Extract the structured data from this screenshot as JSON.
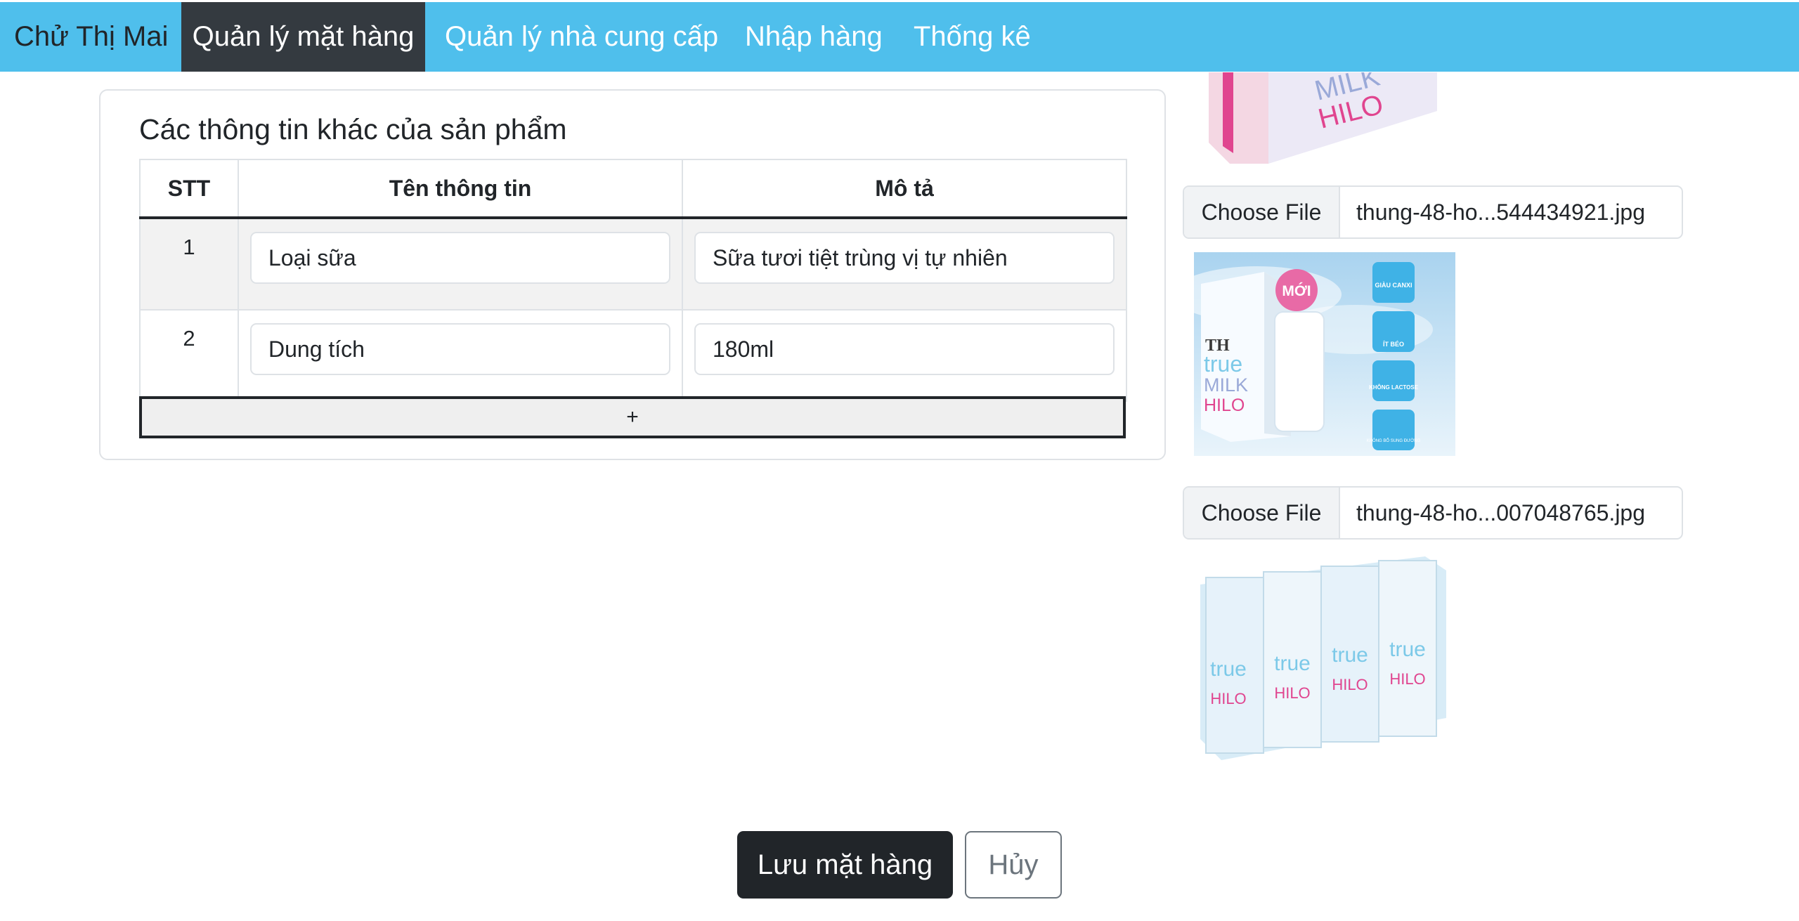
{
  "nav": {
    "brand": "Chử Thị Mai",
    "items": [
      {
        "label": "Quản lý mặt hàng",
        "active": true
      },
      {
        "label": "Quản lý nhà cung cấp",
        "active": false
      },
      {
        "label": "Nhập hàng",
        "active": false
      },
      {
        "label": "Thống kê",
        "active": false
      }
    ]
  },
  "info_card": {
    "title": "Các thông tin khác của sản phẩm",
    "columns": [
      "STT",
      "Tên thông tin",
      "Mô tả"
    ],
    "rows": [
      {
        "stt": "1",
        "name": "Loại sữa",
        "desc": "Sữa tươi tiệt trùng vị tự nhiên"
      },
      {
        "stt": "2",
        "name": "Dung tích",
        "desc": "180ml"
      }
    ],
    "add_label": "+"
  },
  "images": {
    "files": [
      {
        "button": "Choose File",
        "filename": "thung-48-ho...544434921.jpg"
      },
      {
        "button": "Choose File",
        "filename": "thung-48-ho...007048765.jpg"
      }
    ],
    "product_texts": {
      "brand": "TH",
      "true": "true",
      "milk": "MILK",
      "hilo": "HILO",
      "new_badge": "MỚI",
      "feature_1": "GIÀU CANXI",
      "feature_2": "ÍT BÉO",
      "feature_3": "KHÔNG LACTOSE",
      "feature_4": "KHÔNG BỔ SUNG ĐƯỜNG"
    }
  },
  "actions": {
    "save": "Lưu mặt hàng",
    "cancel": "Hủy"
  },
  "colors": {
    "topbar": "#4fbfec",
    "active_tab": "#343a40",
    "primary_button": "#212529",
    "accent_pink": "#e0458f"
  }
}
